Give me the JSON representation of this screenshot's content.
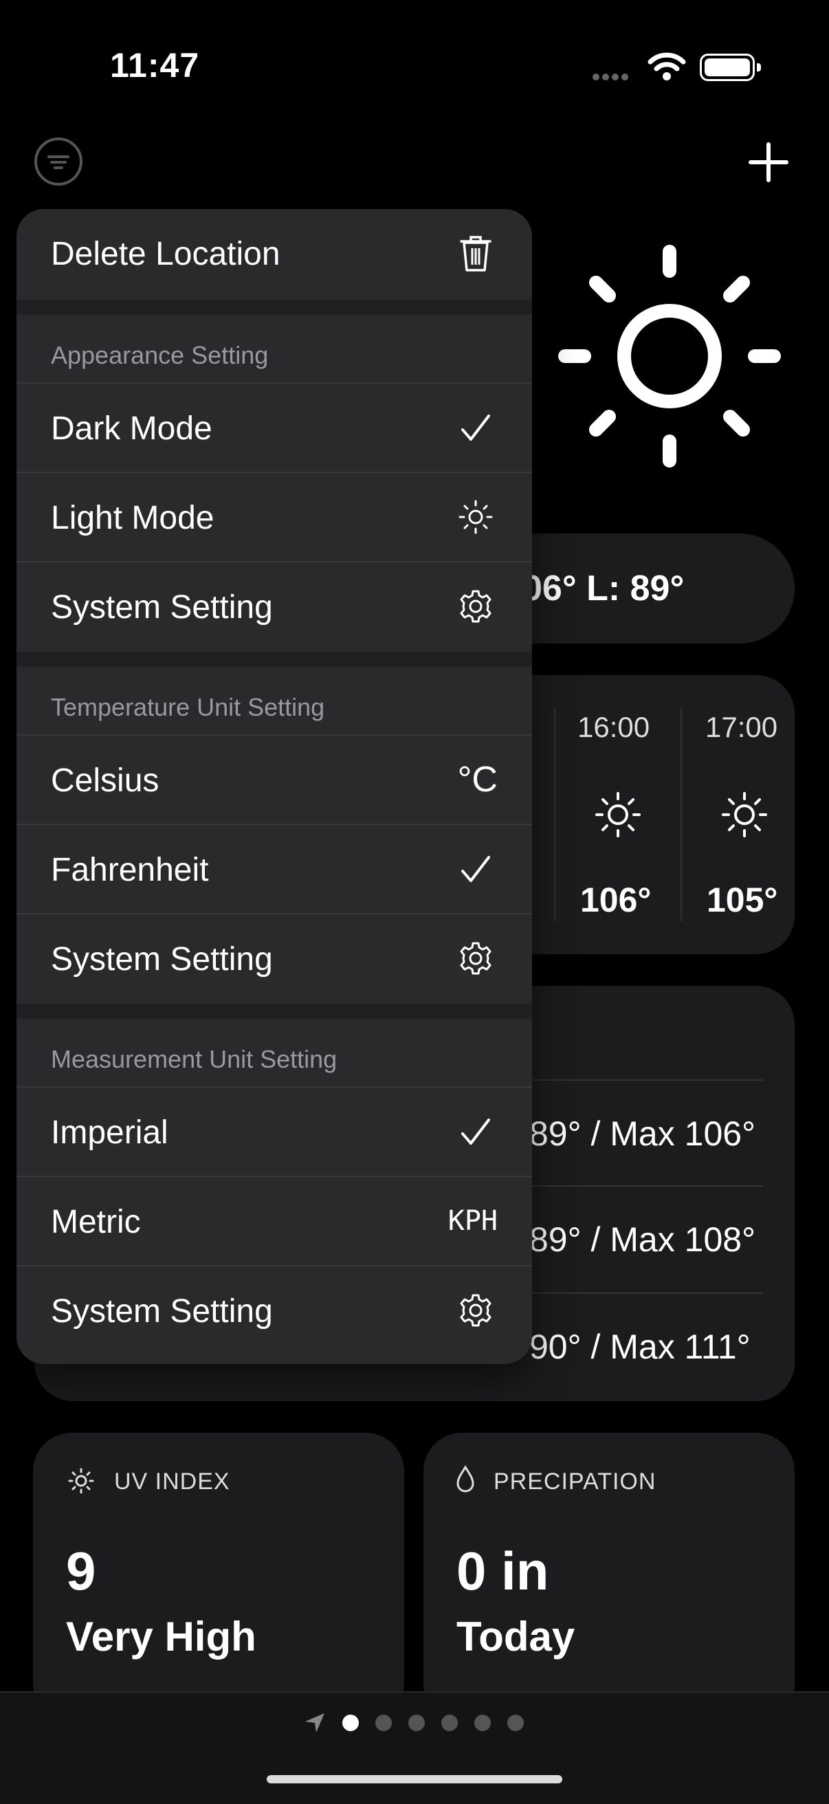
{
  "status": {
    "time": "11:47"
  },
  "menu": {
    "delete_label": "Delete Location",
    "sections": [
      {
        "title": "Appearance Setting",
        "items": [
          {
            "label": "Dark Mode",
            "icon": "checkmark-icon"
          },
          {
            "label": "Light Mode",
            "icon": "sun-icon"
          },
          {
            "label": "System Setting",
            "icon": "gear-icon"
          }
        ]
      },
      {
        "title": "Temperature Unit Setting",
        "items": [
          {
            "label": "Celsius",
            "icon_text": "°C"
          },
          {
            "label": "Fahrenheit",
            "icon": "checkmark-icon"
          },
          {
            "label": "System Setting",
            "icon": "gear-icon"
          }
        ]
      },
      {
        "title": "Measurement Unit Setting",
        "items": [
          {
            "label": "Imperial",
            "icon": "checkmark-icon"
          },
          {
            "label": "Metric",
            "icon_text": "KPH"
          },
          {
            "label": "System Setting",
            "icon": "gear-icon"
          }
        ]
      }
    ]
  },
  "weather": {
    "hl_partial": "06° L: 89°",
    "hourly": [
      {
        "time": "16:00",
        "temp": "106°"
      },
      {
        "time": "17:00",
        "temp": "105°"
      }
    ],
    "daily": [
      "89° / Max 106°",
      "89° / Max 108°",
      "90° / Max 111°"
    ],
    "uv": {
      "label": "UV INDEX",
      "value": "9",
      "desc": "Very High"
    },
    "precip": {
      "label": "PRECIPATION",
      "value": "0 in",
      "desc": "Today"
    }
  }
}
